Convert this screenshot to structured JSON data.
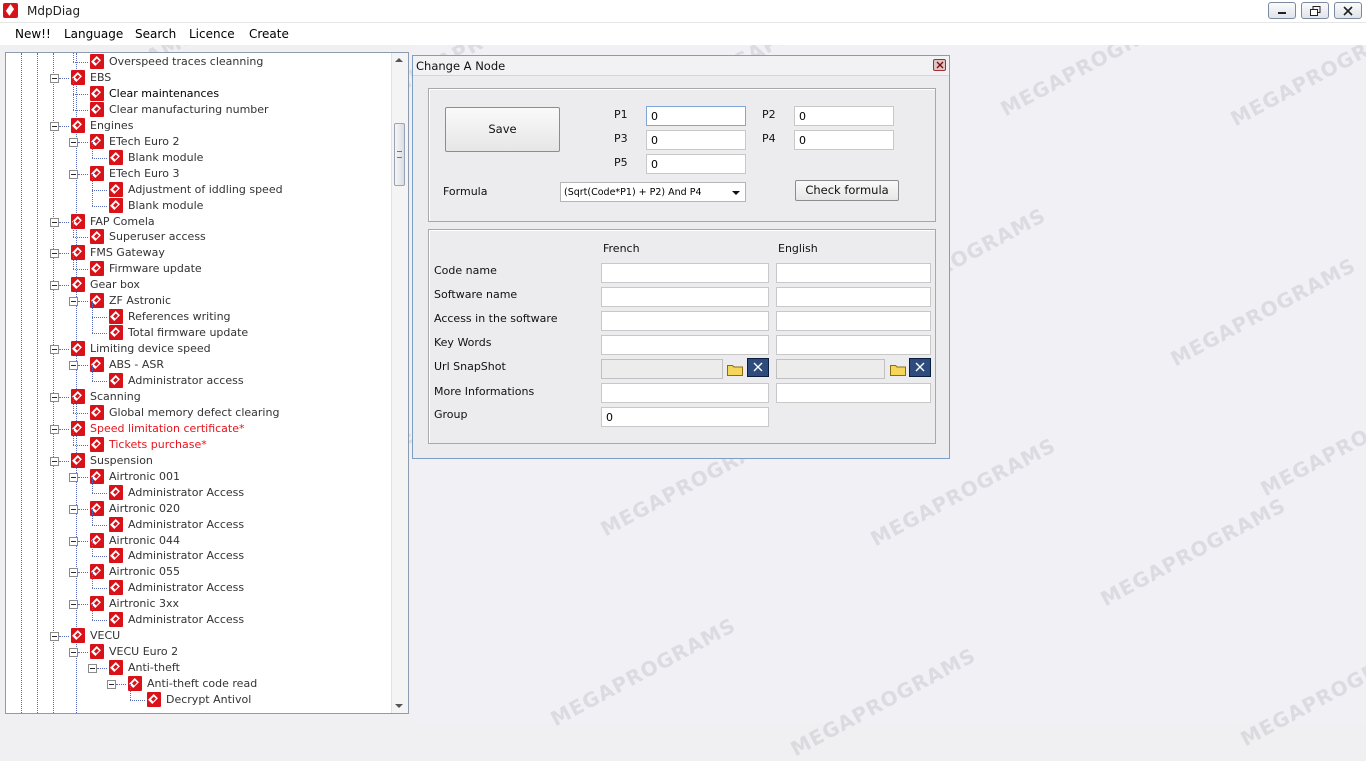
{
  "window": {
    "title": "MdpDiag"
  },
  "menu": [
    "New!!",
    "Language",
    "Search",
    "Licence",
    "Create"
  ],
  "tree": {
    "nodes": [
      {
        "label": "Overspeed traces cleanning",
        "level": 2,
        "style": "normal"
      },
      {
        "label": "EBS",
        "level": 1,
        "style": "normal",
        "expanded": true
      },
      {
        "label": "Clear maintenances",
        "level": 2,
        "style": "bold"
      },
      {
        "label": "Clear manufacturing number",
        "level": 2,
        "style": "normal"
      },
      {
        "label": "Engines",
        "level": 1,
        "style": "normal",
        "expanded": true
      },
      {
        "label": "ETech Euro 2",
        "level": 2,
        "style": "normal",
        "expanded": true
      },
      {
        "label": "Blank module",
        "level": 3,
        "style": "normal"
      },
      {
        "label": "ETech Euro 3",
        "level": 2,
        "style": "normal",
        "expanded": true
      },
      {
        "label": "Adjustment of iddling speed",
        "level": 3,
        "style": "normal"
      },
      {
        "label": "Blank module",
        "level": 3,
        "style": "normal"
      },
      {
        "label": "FAP Comela",
        "level": 1,
        "style": "normal",
        "expanded": true
      },
      {
        "label": "Superuser access",
        "level": 2,
        "style": "normal"
      },
      {
        "label": "FMS Gateway",
        "level": 1,
        "style": "normal",
        "expanded": true
      },
      {
        "label": "Firmware update",
        "level": 2,
        "style": "normal"
      },
      {
        "label": "Gear box",
        "level": 1,
        "style": "normal",
        "expanded": true
      },
      {
        "label": "ZF Astronic",
        "level": 2,
        "style": "normal",
        "expanded": true
      },
      {
        "label": "References writing",
        "level": 3,
        "style": "normal"
      },
      {
        "label": "Total firmware update",
        "level": 3,
        "style": "normal"
      },
      {
        "label": "Limiting device speed",
        "level": 1,
        "style": "normal",
        "expanded": true
      },
      {
        "label": "ABS - ASR",
        "level": 2,
        "style": "normal",
        "expanded": true
      },
      {
        "label": "Administrator access",
        "level": 3,
        "style": "normal"
      },
      {
        "label": "Scanning",
        "level": 1,
        "style": "normal",
        "expanded": true
      },
      {
        "label": "Global memory defect clearing",
        "level": 2,
        "style": "normal"
      },
      {
        "label": "Speed limitation certificate*",
        "level": 1,
        "style": "red",
        "expanded": true
      },
      {
        "label": "Tickets purchase*",
        "level": 2,
        "style": "red"
      },
      {
        "label": "Suspension",
        "level": 1,
        "style": "normal",
        "expanded": true
      },
      {
        "label": "Airtronic 001",
        "level": 2,
        "style": "normal",
        "expanded": true
      },
      {
        "label": "Administrator Access",
        "level": 3,
        "style": "normal"
      },
      {
        "label": "Airtronic 020",
        "level": 2,
        "style": "normal",
        "expanded": true
      },
      {
        "label": "Administrator Access",
        "level": 3,
        "style": "normal"
      },
      {
        "label": "Airtronic 044",
        "level": 2,
        "style": "normal",
        "expanded": true
      },
      {
        "label": "Administrator Access",
        "level": 3,
        "style": "normal"
      },
      {
        "label": "Airtronic 055",
        "level": 2,
        "style": "normal",
        "expanded": true
      },
      {
        "label": "Administrator Access",
        "level": 3,
        "style": "normal"
      },
      {
        "label": "Airtronic 3xx",
        "level": 2,
        "style": "normal",
        "expanded": true
      },
      {
        "label": "Administrator Access",
        "level": 3,
        "style": "normal"
      },
      {
        "label": "VECU",
        "level": 1,
        "style": "normal",
        "expanded": true
      },
      {
        "label": "VECU Euro 2",
        "level": 2,
        "style": "normal",
        "expanded": true
      },
      {
        "label": "Anti-theft",
        "level": 3,
        "style": "normal",
        "expanded": true
      },
      {
        "label": "Anti-theft code read",
        "level": 4,
        "style": "normal",
        "expanded": true
      },
      {
        "label": "Decrypt Antivol",
        "level": 5,
        "style": "normal"
      }
    ]
  },
  "dialog": {
    "title": "Change A Node",
    "save_label": "Save",
    "p1_label": "P1",
    "p1_value": "0",
    "p2_label": "P2",
    "p2_value": "0",
    "p3_label": "P3",
    "p3_value": "0",
    "p4_label": "P4",
    "p4_value": "0",
    "p5_label": "P5",
    "p5_value": "0",
    "formula_label": "Formula",
    "formula_value": "(Sqrt(Code*P1) + P2) And P4",
    "check_formula_label": "Check formula",
    "col_french": "French",
    "col_english": "English",
    "code_name_label": "Code name",
    "software_name_label": "Software name",
    "access_label": "Access in the software",
    "keywords_label": "Key Words",
    "url_snapshot_label": "Url SnapShot",
    "more_info_label": "More Informations",
    "group_label": "Group",
    "group_value": "0"
  },
  "watermark_text": "MEGAPROGRAMS"
}
